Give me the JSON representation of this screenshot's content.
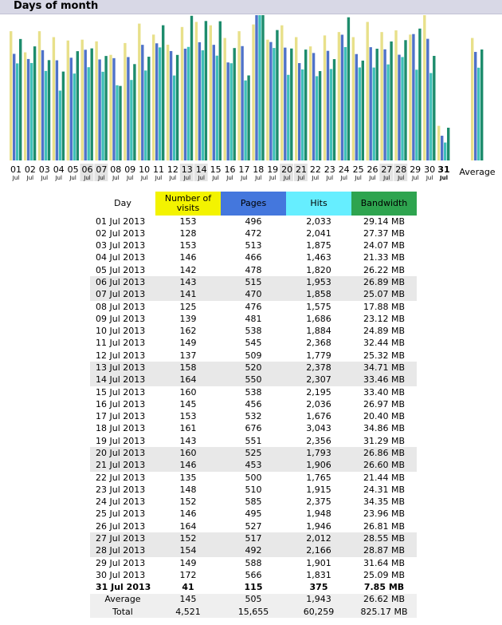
{
  "header": {
    "title": "Days of month"
  },
  "chart_data": {
    "type": "bar",
    "categories": [
      "01",
      "02",
      "03",
      "04",
      "05",
      "06",
      "07",
      "08",
      "09",
      "10",
      "11",
      "12",
      "13",
      "14",
      "15",
      "16",
      "17",
      "18",
      "19",
      "20",
      "21",
      "22",
      "23",
      "24",
      "25",
      "26",
      "27",
      "28",
      "29",
      "30",
      "31"
    ],
    "month_labels": [
      "Jul",
      "Jul",
      "Jul",
      "Jul",
      "Jul",
      "Jul",
      "Jul",
      "Jul",
      "Jul",
      "Jul",
      "Jul",
      "Jul",
      "Jul",
      "Jul",
      "Jul",
      "Jul",
      "Jul",
      "Jul",
      "Jul",
      "Jul",
      "Jul",
      "Jul",
      "Jul",
      "Jul",
      "Jul",
      "Jul",
      "Jul",
      "Jul",
      "Jul",
      "Jul",
      "Jul"
    ],
    "weekend_indices": [
      5,
      6,
      12,
      13,
      19,
      20,
      26,
      27
    ],
    "today_index": 30,
    "average_label": "Average",
    "series": [
      {
        "name": "Number of visits",
        "color": "#e8e08a",
        "values": [
          153,
          128,
          153,
          146,
          142,
          143,
          141,
          125,
          139,
          162,
          149,
          137,
          158,
          164,
          160,
          145,
          153,
          161,
          143,
          160,
          146,
          135,
          148,
          152,
          146,
          164,
          152,
          154,
          149,
          172,
          41
        ],
        "average": 145
      },
      {
        "name": "Pages",
        "color": "#4f72c9",
        "values": [
          496,
          472,
          513,
          466,
          478,
          515,
          470,
          476,
          481,
          538,
          545,
          509,
          520,
          550,
          538,
          456,
          532,
          676,
          551,
          525,
          453,
          500,
          510,
          585,
          495,
          527,
          517,
          492,
          588,
          566,
          115
        ],
        "average": 505
      },
      {
        "name": "Hits",
        "color": "#3fc0b8",
        "values": [
          2033,
          2041,
          1875,
          1463,
          1820,
          1953,
          1858,
          1575,
          1686,
          1884,
          2368,
          1779,
          2378,
          2307,
          2195,
          2036,
          1676,
          3043,
          2356,
          1793,
          1906,
          1765,
          1915,
          2375,
          1948,
          1946,
          2012,
          2166,
          1901,
          1831,
          375
        ],
        "average": 1943
      },
      {
        "name": "Bandwidth",
        "color": "#1d8c6c",
        "values": [
          29.14,
          27.37,
          24.07,
          21.33,
          26.22,
          26.89,
          25.07,
          17.88,
          23.12,
          24.89,
          32.44,
          25.32,
          34.71,
          33.46,
          33.4,
          26.97,
          20.4,
          34.86,
          31.29,
          26.86,
          26.6,
          21.44,
          24.31,
          34.35,
          23.96,
          26.81,
          28.55,
          28.87,
          31.64,
          25.09,
          7.85
        ],
        "average": 26.62
      }
    ]
  },
  "table": {
    "headers": [
      "Day",
      "Number of visits",
      "Pages",
      "Hits",
      "Bandwidth"
    ],
    "rows": [
      [
        "01 Jul 2013",
        "153",
        "496",
        "2,033",
        "29.14 MB"
      ],
      [
        "02 Jul 2013",
        "128",
        "472",
        "2,041",
        "27.37 MB"
      ],
      [
        "03 Jul 2013",
        "153",
        "513",
        "1,875",
        "24.07 MB"
      ],
      [
        "04 Jul 2013",
        "146",
        "466",
        "1,463",
        "21.33 MB"
      ],
      [
        "05 Jul 2013",
        "142",
        "478",
        "1,820",
        "26.22 MB"
      ],
      [
        "06 Jul 2013",
        "143",
        "515",
        "1,953",
        "26.89 MB"
      ],
      [
        "07 Jul 2013",
        "141",
        "470",
        "1,858",
        "25.07 MB"
      ],
      [
        "08 Jul 2013",
        "125",
        "476",
        "1,575",
        "17.88 MB"
      ],
      [
        "09 Jul 2013",
        "139",
        "481",
        "1,686",
        "23.12 MB"
      ],
      [
        "10 Jul 2013",
        "162",
        "538",
        "1,884",
        "24.89 MB"
      ],
      [
        "11 Jul 2013",
        "149",
        "545",
        "2,368",
        "32.44 MB"
      ],
      [
        "12 Jul 2013",
        "137",
        "509",
        "1,779",
        "25.32 MB"
      ],
      [
        "13 Jul 2013",
        "158",
        "520",
        "2,378",
        "34.71 MB"
      ],
      [
        "14 Jul 2013",
        "164",
        "550",
        "2,307",
        "33.46 MB"
      ],
      [
        "15 Jul 2013",
        "160",
        "538",
        "2,195",
        "33.40 MB"
      ],
      [
        "16 Jul 2013",
        "145",
        "456",
        "2,036",
        "26.97 MB"
      ],
      [
        "17 Jul 2013",
        "153",
        "532",
        "1,676",
        "20.40 MB"
      ],
      [
        "18 Jul 2013",
        "161",
        "676",
        "3,043",
        "34.86 MB"
      ],
      [
        "19 Jul 2013",
        "143",
        "551",
        "2,356",
        "31.29 MB"
      ],
      [
        "20 Jul 2013",
        "160",
        "525",
        "1,793",
        "26.86 MB"
      ],
      [
        "21 Jul 2013",
        "146",
        "453",
        "1,906",
        "26.60 MB"
      ],
      [
        "22 Jul 2013",
        "135",
        "500",
        "1,765",
        "21.44 MB"
      ],
      [
        "23 Jul 2013",
        "148",
        "510",
        "1,915",
        "24.31 MB"
      ],
      [
        "24 Jul 2013",
        "152",
        "585",
        "2,375",
        "34.35 MB"
      ],
      [
        "25 Jul 2013",
        "146",
        "495",
        "1,948",
        "23.96 MB"
      ],
      [
        "26 Jul 2013",
        "164",
        "527",
        "1,946",
        "26.81 MB"
      ],
      [
        "27 Jul 2013",
        "152",
        "517",
        "2,012",
        "28.55 MB"
      ],
      [
        "28 Jul 2013",
        "154",
        "492",
        "2,166",
        "28.87 MB"
      ],
      [
        "29 Jul 2013",
        "149",
        "588",
        "1,901",
        "31.64 MB"
      ],
      [
        "30 Jul 2013",
        "172",
        "566",
        "1,831",
        "25.09 MB"
      ],
      [
        "31 Jul 2013",
        "41",
        "115",
        "375",
        "7.85 MB"
      ]
    ],
    "average": [
      "Average",
      "145",
      "505",
      "1,943",
      "26.62 MB"
    ],
    "total": [
      "Total",
      "4,521",
      "15,655",
      "60,259",
      "825.17 MB"
    ]
  }
}
